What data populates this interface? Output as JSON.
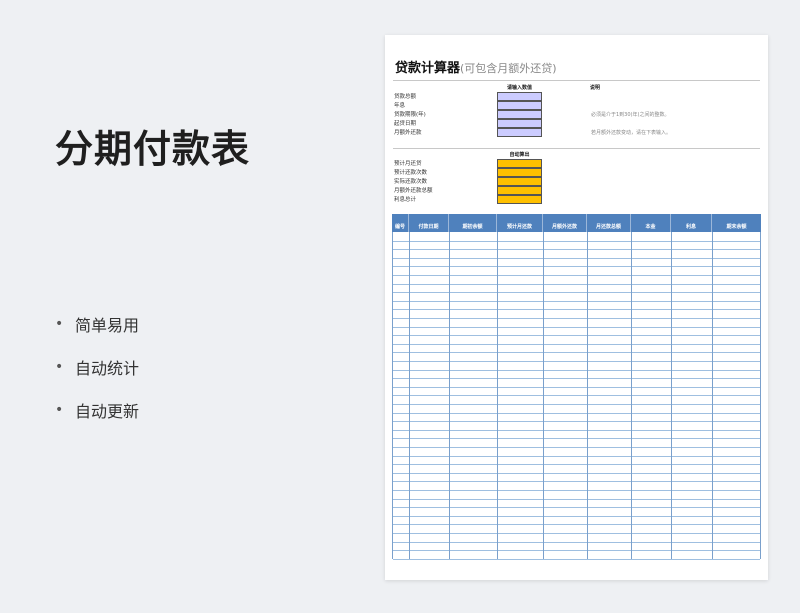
{
  "title": "分期付款表",
  "features": [
    "简单易用",
    "自动统计",
    "自动更新"
  ],
  "bullet": "•",
  "sheet": {
    "title": "贷款计算器",
    "subtitle": "(可包含月额外还贷)",
    "input_header": "请输入数值",
    "note_header": "说明",
    "input_labels": [
      "贷款总额",
      "年息",
      "贷款期限(年)",
      "起贷日期",
      "月额外还款"
    ],
    "notes": [
      "",
      "",
      "必须是介于1到30(年)之间的整数。",
      "",
      "若月额外还款变动，请在下表输入。"
    ],
    "output_header": "自动算出",
    "output_labels": [
      "预计月还贷",
      "预计还款次数",
      "实际还款次数",
      "月额外还款总额",
      "利息总计"
    ],
    "columns": [
      "编号",
      "付款日期",
      "期初余额",
      "预计月还款",
      "月额外还款",
      "月还款总额",
      "本金",
      "利息",
      "期末余额"
    ]
  }
}
